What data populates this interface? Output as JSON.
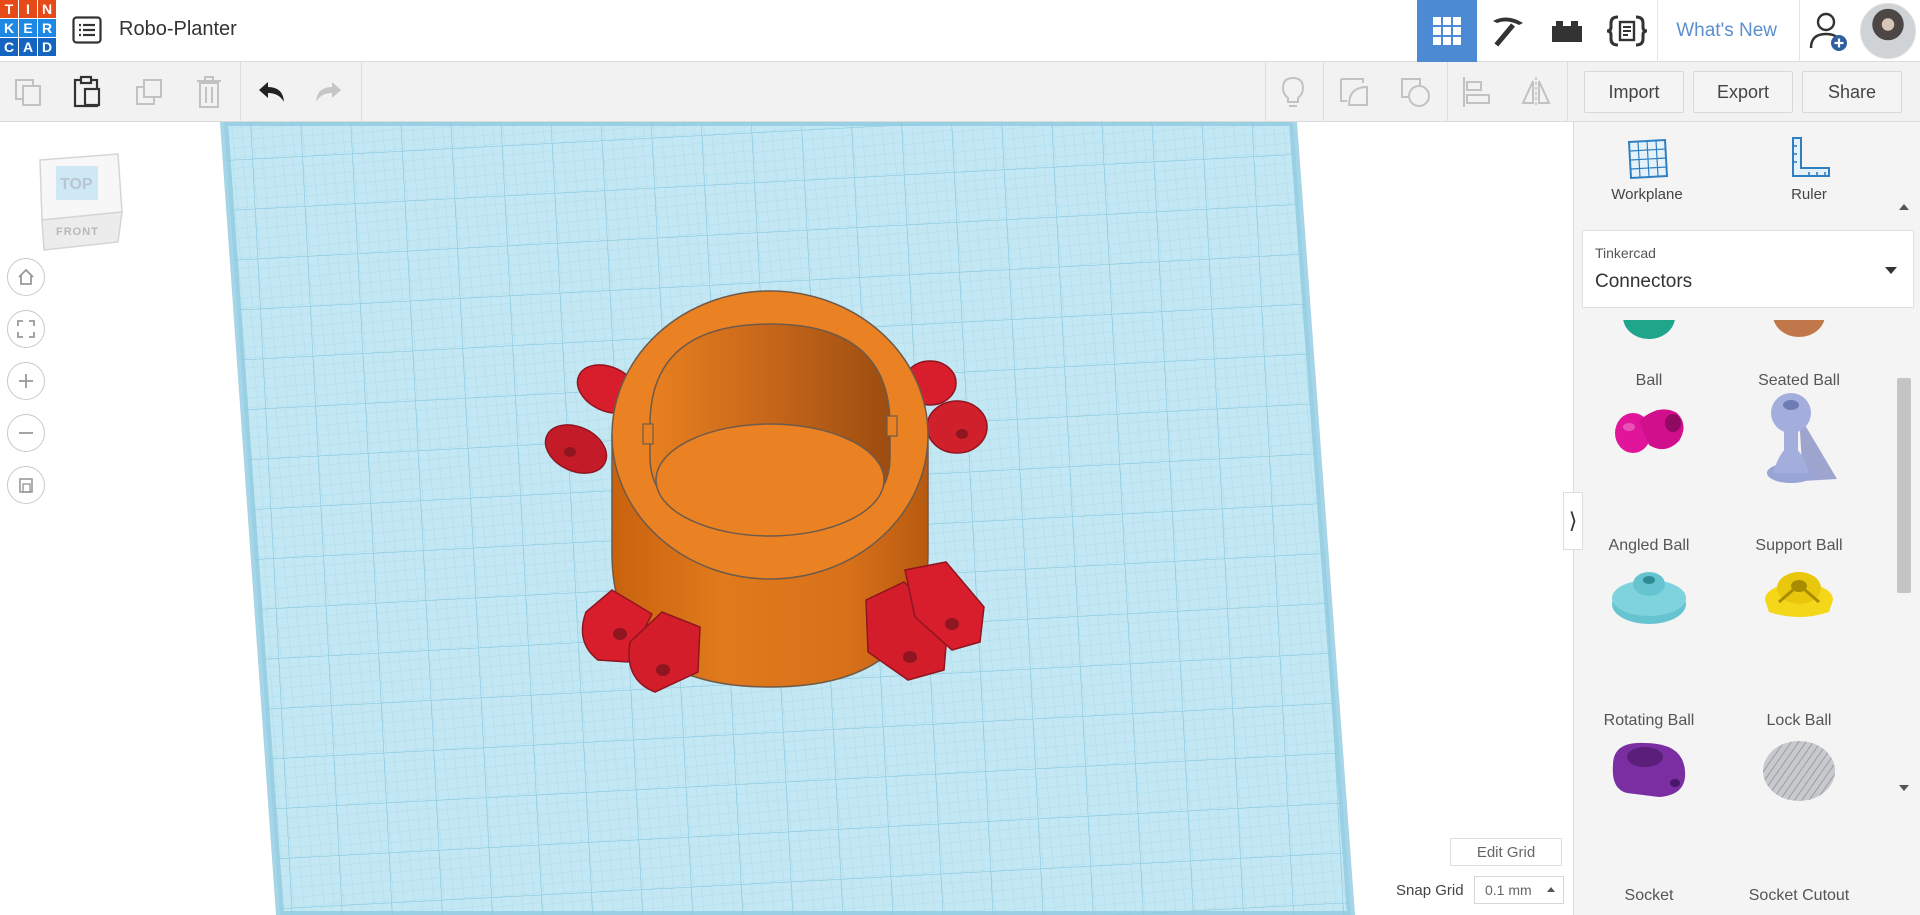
{
  "app": {
    "logo_letters": [
      "T",
      "I",
      "N",
      "K",
      "E",
      "R",
      "C",
      "A",
      "D"
    ],
    "design_title": "Robo-Planter"
  },
  "topnav": {
    "whats_new": "What's New"
  },
  "toolbar": {
    "import_label": "Import",
    "export_label": "Export",
    "share_label": "Share"
  },
  "viewcube": {
    "top_label": "TOP",
    "front_label": "FRONT"
  },
  "workspace": {
    "edit_grid_label": "Edit Grid",
    "snap_grid_label": "Snap Grid",
    "snap_grid_value": "0.1 mm"
  },
  "panel": {
    "workplane_label": "Workplane",
    "ruler_label": "Ruler",
    "library_owner": "Tinkercad",
    "library_name": "Connectors",
    "shapes": [
      {
        "label": "Ball",
        "icon": "ball-icon",
        "color": "#1fa58a"
      },
      {
        "label": "Seated Ball",
        "icon": "seated-ball-icon",
        "color": "#c0784a"
      },
      {
        "label": "Angled Ball",
        "icon": "angled-ball-icon",
        "color": "#e0159a"
      },
      {
        "label": "Support Ball",
        "icon": "support-ball-icon",
        "color": "#a4aedd"
      },
      {
        "label": "Rotating Ball",
        "icon": "rotating-ball-icon",
        "color": "#66c4d0"
      },
      {
        "label": "Lock Ball",
        "icon": "lock-ball-icon",
        "color": "#f4d718"
      },
      {
        "label": "Socket",
        "icon": "socket-icon",
        "color": "#7a2ea1"
      },
      {
        "label": "Socket Cutout",
        "icon": "socket-cutout-icon",
        "color": "#b8babd"
      }
    ]
  },
  "colors": {
    "accent": "#4d8ad4",
    "workplane": "#bfe6f2",
    "body": "#e67e22",
    "parts": "#d81e2c"
  }
}
